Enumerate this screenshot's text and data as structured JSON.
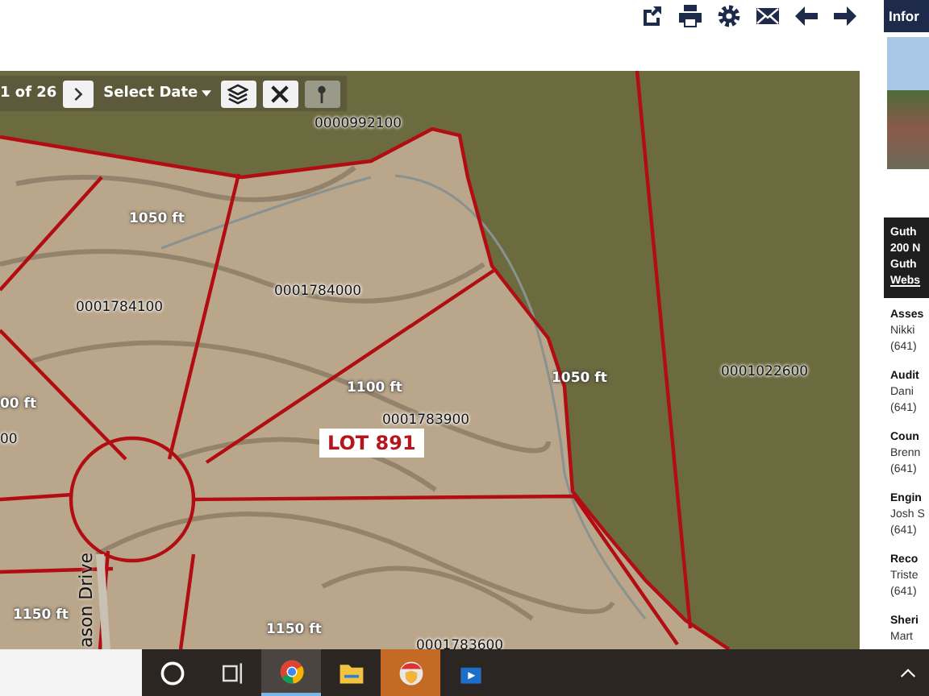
{
  "toolbar": {
    "actions": [
      {
        "kind": "share"
      },
      {
        "kind": "print"
      },
      {
        "kind": "settings"
      },
      {
        "kind": "mail"
      },
      {
        "kind": "back"
      },
      {
        "kind": "forward"
      }
    ]
  },
  "map": {
    "pager": "1 of 26",
    "date_select": "Select Date",
    "tools": [
      {
        "kind": "layers",
        "disabled": false
      },
      {
        "kind": "tools",
        "disabled": false
      },
      {
        "kind": "pin",
        "disabled": true
      }
    ],
    "labels": [
      {
        "kind": "parcel",
        "text": "0000992100"
      },
      {
        "kind": "contour",
        "text": "1050 ft"
      },
      {
        "kind": "parcel",
        "text": "0001784000"
      },
      {
        "kind": "parcel",
        "text": "0001784100"
      },
      {
        "kind": "contour",
        "text": "00 ft"
      },
      {
        "kind": "parcel",
        "text": "00"
      },
      {
        "kind": "contour",
        "text": "1100 ft"
      },
      {
        "kind": "parcel",
        "text": "0001783900"
      },
      {
        "kind": "contour",
        "text": "1050 ft"
      },
      {
        "kind": "parcel",
        "text": "0001022600"
      },
      {
        "kind": "contour",
        "text": "1150 ft"
      },
      {
        "kind": "contour",
        "text": "1150 ft"
      },
      {
        "kind": "parcel",
        "text": "0001783600"
      }
    ],
    "lot_label": "LOT 891",
    "street": "ason Drive"
  },
  "info_panel": {
    "title": "Infor",
    "office": [
      "Guth",
      "200 N",
      "Guth"
    ],
    "link": "Webs",
    "contacts": [
      {
        "title": "Asses",
        "name": "Nikki",
        "phone": "(641)"
      },
      {
        "title": "Audit",
        "name": "Dani",
        "phone": "(641)"
      },
      {
        "title": "Coun",
        "name": "Brenn",
        "phone": "(641)"
      },
      {
        "title": "Engin",
        "name": "Josh S",
        "phone": "(641)"
      },
      {
        "title": "Reco",
        "name": "Triste",
        "phone": "(641)"
      },
      {
        "title": "Sheri",
        "name": "Mart"
      }
    ]
  },
  "taskbar": {
    "buttons": [
      {
        "kind": "cortana",
        "selected": false
      },
      {
        "kind": "task-view",
        "selected": false
      },
      {
        "kind": "chrome",
        "selected": true
      },
      {
        "kind": "explorer",
        "selected": false
      },
      {
        "kind": "shield-app",
        "selected": false
      },
      {
        "kind": "media",
        "selected": false
      }
    ]
  }
}
